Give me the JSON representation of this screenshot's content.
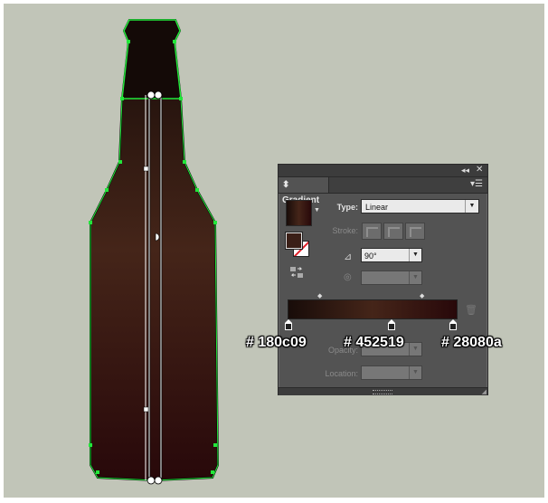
{
  "panel": {
    "tab_label": "Gradient",
    "collapse_glyph": "◂◂",
    "close_glyph": "✕",
    "menu_glyph": "▾☰",
    "type_label": "Type:",
    "type_value": "Linear",
    "stroke_label": "Stroke:",
    "angle_value": "90°",
    "opacity_label": "Opacity:",
    "location_label": "Location:",
    "stops": [
      "#180c09",
      "#452519",
      "#28080a"
    ],
    "icons": {
      "angle": "angle-icon",
      "aspect": "aspect-ratio-icon",
      "reverse": "reverse-gradient-icon",
      "delete": "trash-icon"
    }
  },
  "annotations": {
    "stop_1": "# 180c09",
    "stop_2": "# 452519",
    "stop_3": "# 28080a"
  },
  "colors": {
    "canvas": "#c1c5b8",
    "selection": "#22e63a",
    "bottle_dark": "#140a07",
    "bottle_mid": "#452519",
    "bottle_edge": "#28080a"
  }
}
